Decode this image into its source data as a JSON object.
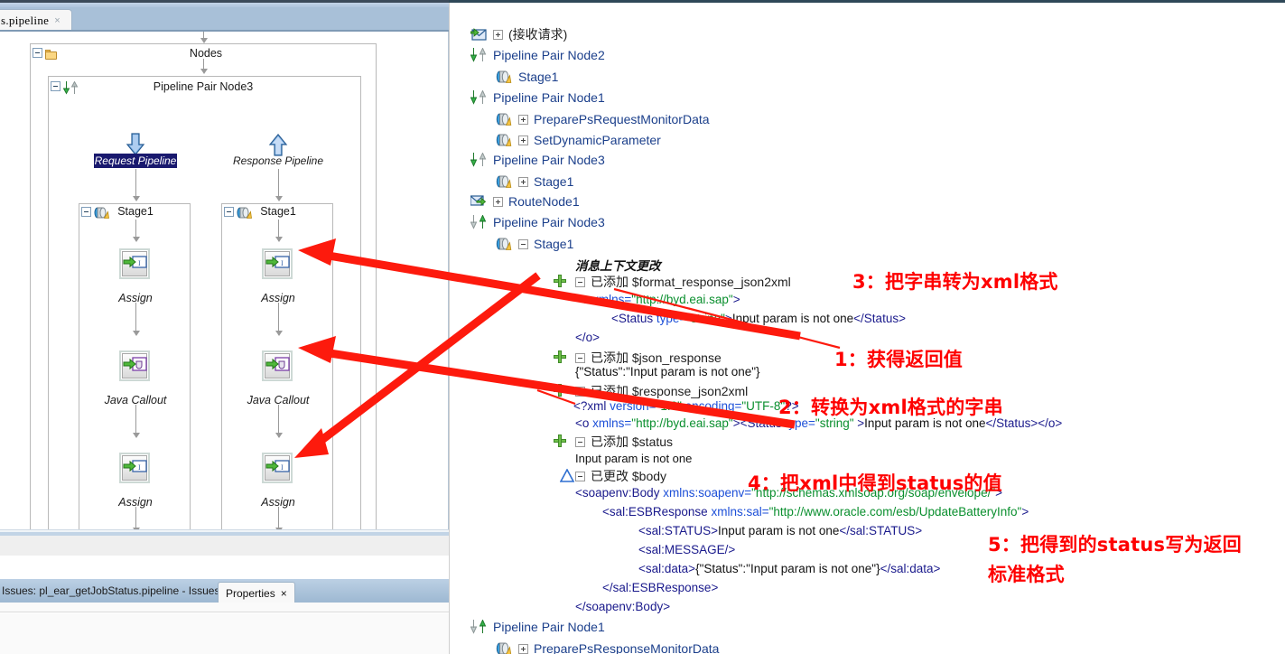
{
  "editor": {
    "tab_label": "s.pipeline",
    "tab_close": "×"
  },
  "diagram": {
    "nodes_label": "Nodes",
    "pipeline_pair_label": "Pipeline Pair Node3",
    "request_pipeline_label": "Request Pipeline",
    "response_pipeline_label": "Response Pipeline",
    "stage_label_left": "Stage1",
    "stage_label_right": "Stage1",
    "actions_left": [
      "Assign",
      "Java Callout",
      "Assign"
    ],
    "actions_right": [
      "Assign",
      "Java Callout",
      "Assign"
    ]
  },
  "bottom": {
    "issues_tab": "Issues: pl_ear_getJobStatus.pipeline - Issues",
    "properties_tab": "Properties",
    "properties_close": "×"
  },
  "tree": {
    "rows": [
      {
        "label": "(接收请求)",
        "icon": "envelope-in-icon",
        "expander": "plus",
        "indent": 0
      },
      {
        "label": "Pipeline Pair Node2",
        "icon": "pipeline-pair-down-icon",
        "expander": "none",
        "indent": 0
      },
      {
        "label": "Stage1",
        "icon": "stage-icon",
        "expander": "none",
        "indent": 1
      },
      {
        "label": "Pipeline Pair Node1",
        "icon": "pipeline-pair-down-icon",
        "expander": "none",
        "indent": 0
      },
      {
        "label": "PreparePsRequestMonitorData",
        "icon": "stage-icon",
        "expander": "plus",
        "indent": 1
      },
      {
        "label": "SetDynamicParameter",
        "icon": "stage-icon",
        "expander": "plus",
        "indent": 1
      },
      {
        "label": "Pipeline Pair Node3",
        "icon": "pipeline-pair-down-icon",
        "expander": "none",
        "indent": 0
      },
      {
        "label": "Stage1",
        "icon": "stage-icon",
        "expander": "plus",
        "indent": 1
      },
      {
        "label": "RouteNode1",
        "icon": "envelope-route-icon",
        "expander": "plus",
        "indent": 0
      },
      {
        "label": "Pipeline Pair Node3",
        "icon": "pipeline-pair-up-icon",
        "expander": "none",
        "indent": 0
      },
      {
        "label": "Stage1",
        "icon": "stage-icon",
        "expander": "minus",
        "indent": 1
      }
    ],
    "context_header": "消息上下文更改",
    "tail_rows": [
      {
        "label": "Pipeline Pair Node1",
        "icon": "pipeline-pair-down-icon",
        "expander": "none",
        "indent": 0
      },
      {
        "label": "PreparePsResponseMonitorData",
        "icon": "stage-icon",
        "expander": "plus",
        "indent": 1
      }
    ],
    "changes": [
      {
        "marker": "plus",
        "expander": "minus",
        "label": "已添加 $format_response_json2xml"
      },
      {
        "marker": "plus",
        "expander": "minus",
        "label": "已添加 $json_response"
      },
      {
        "marker": "plus",
        "expander": "minus",
        "label": "已添加 $response_json2xml"
      },
      {
        "marker": "plus",
        "expander": "minus",
        "label": "已添加 $status"
      },
      {
        "marker": "delta",
        "expander": "minus",
        "label": "已更改 $body"
      }
    ],
    "code": {
      "l1": {
        "tag1": "<o ",
        "attr": "xmlns=",
        "val": "\"http://byd.eai.sap\"",
        "tag2": ">"
      },
      "l2": {
        "tag1": "<Status ",
        "attr": "type=",
        "val": "\"string\"",
        "tag2": ">",
        "text": "Input param is not one",
        "tag3": "</Status>"
      },
      "l3": "</o>",
      "json_response": "{\"Status\":\"Input param is not one\"}",
      "xmldecl": {
        "p1": "<?xml ",
        "a1": "version=",
        "v1": "\"1.0\"",
        "a2": " encoding=",
        "v2": "\"UTF-8\"",
        "p2": "?>"
      },
      "l5": {
        "t1": "<o ",
        "a1": "xmlns=",
        "v1": "\"http://byd.eai.sap\"",
        "t2": "><Status ",
        "a2": "type=",
        "v2": "\"string\"",
        "t3": " >",
        "tx": "Input param is not one",
        "t4": "</Status></o>"
      },
      "status_value": "Input param is not one",
      "body1": {
        "t1": "<soapenv:Body ",
        "a1": "xmlns:soapenv=",
        "v1": "\"http://schemas.xmlsoap.org/soap/envelope/\"",
        "t2": ">"
      },
      "body2": {
        "t1": "<sal:ESBResponse ",
        "a1": "xmlns:sal=",
        "v1": "\"http://www.oracle.com/esb/UpdateBatteryInfo\"",
        "t2": ">"
      },
      "body3": {
        "t1": "<sal:STATUS>",
        "tx": "Input param is not one",
        "t2": "</sal:STATUS>"
      },
      "body4": "<sal:MESSAGE/>",
      "body5": {
        "t1": "<sal:data>",
        "tx": "{\"Status\":\"Input param is not one\"}",
        "t2": "</sal:data>"
      },
      "body6": "</sal:ESBResponse>",
      "body7": "</soapenv:Body>"
    }
  },
  "annotations": {
    "a1": "1：获得返回值",
    "a2": "2：转换为xml格式的字串",
    "a3": "3：把字串转为xml格式",
    "a4": "4：把xml中得到status的值",
    "a5_line1": "5：把得到的status写为返回",
    "a5_line2": "标准格式",
    "color": "#fe0000"
  }
}
